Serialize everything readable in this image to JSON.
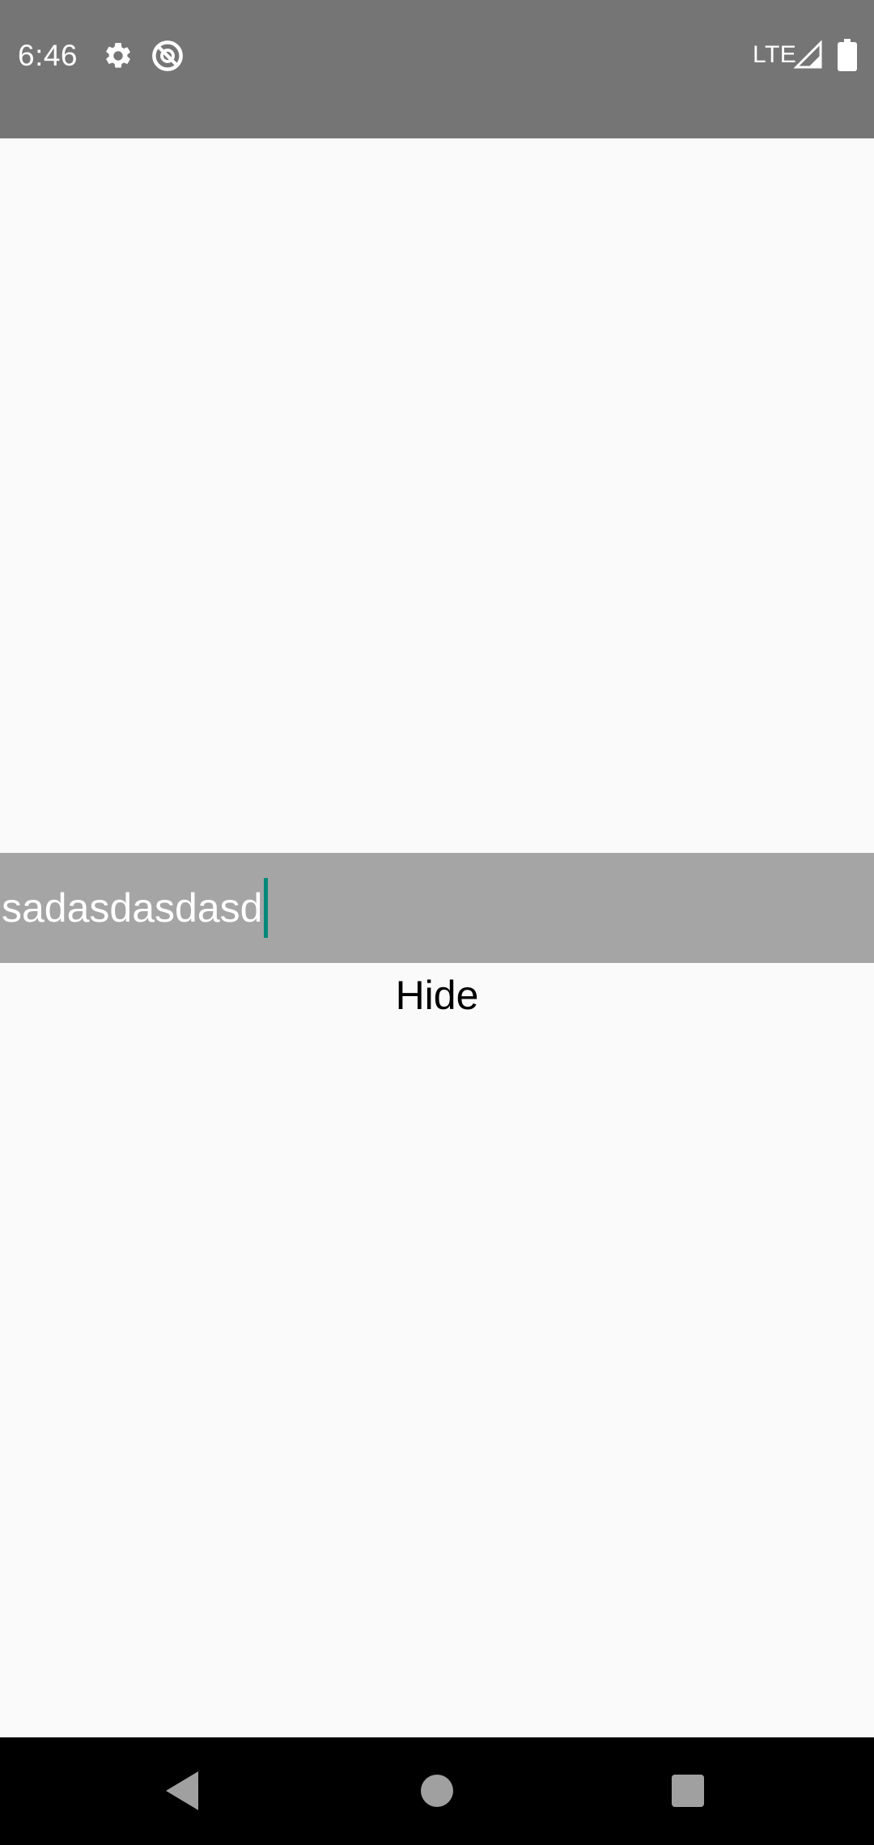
{
  "status_bar": {
    "time": "6:46",
    "network": "LTE",
    "icons": [
      "gear-icon",
      "do-not-disturb-icon",
      "signal-icon",
      "battery-icon"
    ]
  },
  "input": {
    "value": "sadasdasdasd"
  },
  "hide_button": {
    "label": "Hide"
  },
  "nav_bar": {
    "icons": [
      "back-icon",
      "home-icon",
      "recents-icon"
    ]
  },
  "colors": {
    "status_bar": "#757575",
    "background": "#fafafa",
    "input_band": "#a5a5a6",
    "cursor": "#00897b",
    "nav_bar": "#000000"
  }
}
